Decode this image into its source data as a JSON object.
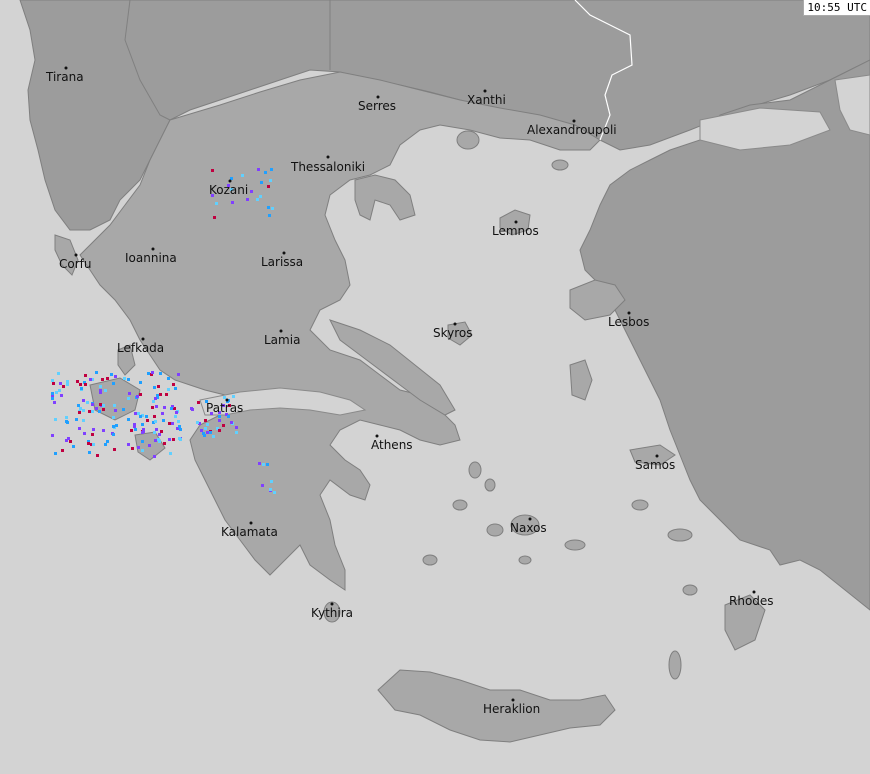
{
  "timestamp": "10:55 UTC",
  "colors": {
    "sea": "#d3d3d3",
    "greece": "#a8a8a8",
    "neighbors": "#9c9c9c",
    "strike_recent": "#c00040",
    "strike_mid": "#8040ff",
    "strike_old": "#20a0ff",
    "strike_older": "#60d0ff"
  },
  "cities": [
    {
      "name": "Tirana"
    },
    {
      "name": "Serres"
    },
    {
      "name": "Xanthi"
    },
    {
      "name": "Alexandroupoli"
    },
    {
      "name": "Thessaloniki"
    },
    {
      "name": "Kozani"
    },
    {
      "name": "Lemnos"
    },
    {
      "name": "Corfu"
    },
    {
      "name": "Ioannina"
    },
    {
      "name": "Larissa"
    },
    {
      "name": "Skyros"
    },
    {
      "name": "Lesbos"
    },
    {
      "name": "Lefkada"
    },
    {
      "name": "Lamia"
    },
    {
      "name": "Patras"
    },
    {
      "name": "Athens"
    },
    {
      "name": "Samos"
    },
    {
      "name": "Naxos"
    },
    {
      "name": "Kalamata"
    },
    {
      "name": "Kythira"
    },
    {
      "name": "Rhodes"
    },
    {
      "name": "Heraklion"
    }
  ]
}
